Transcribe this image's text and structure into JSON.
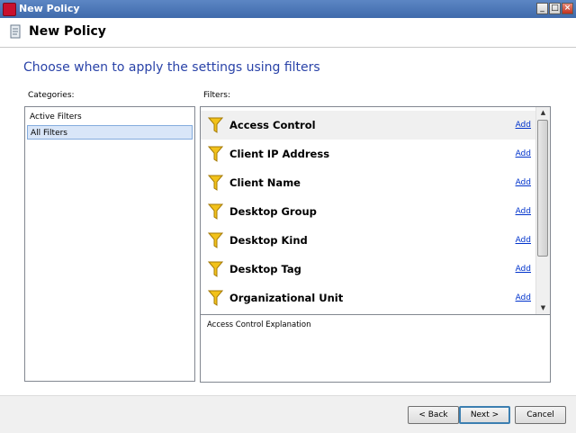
{
  "window": {
    "title": "New Policy",
    "buttons": {
      "minimize": "_",
      "maximize": "□",
      "close": "×"
    }
  },
  "header": {
    "title": "New Policy"
  },
  "subtitle": "Choose when to apply the settings using filters",
  "categories": {
    "label": "Categories:",
    "items": [
      {
        "label": "Active Filters",
        "selected": false
      },
      {
        "label": "All Filters",
        "selected": true
      }
    ]
  },
  "filters": {
    "label": "Filters:",
    "add_label": "Add",
    "items": [
      {
        "name": "Access Control"
      },
      {
        "name": "Client IP Address"
      },
      {
        "name": "Client Name"
      },
      {
        "name": "Desktop Group"
      },
      {
        "name": "Desktop Kind"
      },
      {
        "name": "Desktop Tag"
      },
      {
        "name": "Organizational Unit"
      }
    ]
  },
  "explanation": {
    "text": "Access Control Explanation"
  },
  "buttons": {
    "back": "< Back",
    "next": "Next >",
    "cancel": "Cancel"
  },
  "colors": {
    "subtitle": "#2a43a8",
    "link": "#0033cc",
    "funnel": "#f2c21b",
    "selected_bg": "#d9e6f8"
  }
}
